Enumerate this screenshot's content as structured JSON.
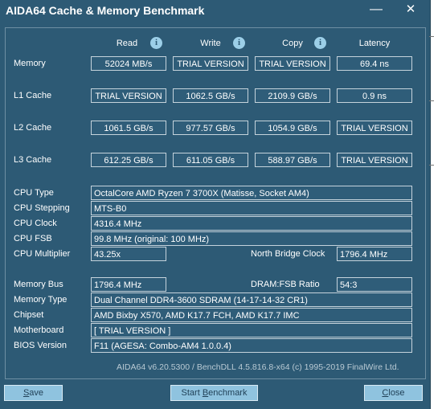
{
  "window": {
    "title": "AIDA64 Cache & Memory Benchmark",
    "minimize_glyph": "—",
    "close_glyph": "✕"
  },
  "columns": {
    "read": "Read",
    "write": "Write",
    "copy": "Copy",
    "latency": "Latency",
    "info_glyph": "i"
  },
  "rows": {
    "memory": {
      "label": "Memory",
      "read": "52024 MB/s",
      "write": "TRIAL VERSION",
      "copy": "TRIAL VERSION",
      "latency": "69.4 ns"
    },
    "l1": {
      "label": "L1 Cache",
      "read": "TRIAL VERSION",
      "write": "1062.5 GB/s",
      "copy": "2109.9 GB/s",
      "latency": "0.9 ns"
    },
    "l2": {
      "label": "L2 Cache",
      "read": "1061.5 GB/s",
      "write": "977.57 GB/s",
      "copy": "1054.9 GB/s",
      "latency": "TRIAL VERSION"
    },
    "l3": {
      "label": "L3 Cache",
      "read": "612.25 GB/s",
      "write": "611.05 GB/s",
      "copy": "588.97 GB/s",
      "latency": "TRIAL VERSION"
    }
  },
  "info": {
    "cpu_type": {
      "label": "CPU Type",
      "value": "OctalCore AMD Ryzen 7 3700X  (Matisse, Socket AM4)"
    },
    "cpu_stepping": {
      "label": "CPU Stepping",
      "value": "MTS-B0"
    },
    "cpu_clock": {
      "label": "CPU Clock",
      "value": "4316.4 MHz"
    },
    "cpu_fsb": {
      "label": "CPU FSB",
      "value": "99.8 MHz  (original: 100 MHz)"
    },
    "cpu_multiplier": {
      "label": "CPU Multiplier",
      "value": "43.25x"
    },
    "north_bridge_clock": {
      "label": "North Bridge Clock",
      "value": "1796.4 MHz"
    },
    "memory_bus": {
      "label": "Memory Bus",
      "value": "1796.4 MHz"
    },
    "dram_fsb_ratio": {
      "label": "DRAM:FSB Ratio",
      "value": "54:3"
    },
    "memory_type": {
      "label": "Memory Type",
      "value": "Dual Channel DDR4-3600 SDRAM  (14-17-14-32 CR1)"
    },
    "chipset": {
      "label": "Chipset",
      "value": "AMD Bixby X570, AMD K17.7 FCH, AMD K17.7 IMC"
    },
    "motherboard": {
      "label": "Motherboard",
      "value": "[ TRIAL VERSION ]"
    },
    "bios_version": {
      "label": "BIOS Version",
      "value": "F11  (AGESA: Combo-AM4 1.0.0.4)"
    }
  },
  "footer": "AIDA64 v6.20.5300 / BenchDLL 4.5.816.8-x64  (c) 1995-2019 FinalWire Ltd.",
  "buttons": {
    "save_first": "S",
    "save_rest": "ave",
    "start_pre": "Start ",
    "start_u": "B",
    "start_post": "enchmark",
    "close_first": "C",
    "close_rest": "lose"
  }
}
